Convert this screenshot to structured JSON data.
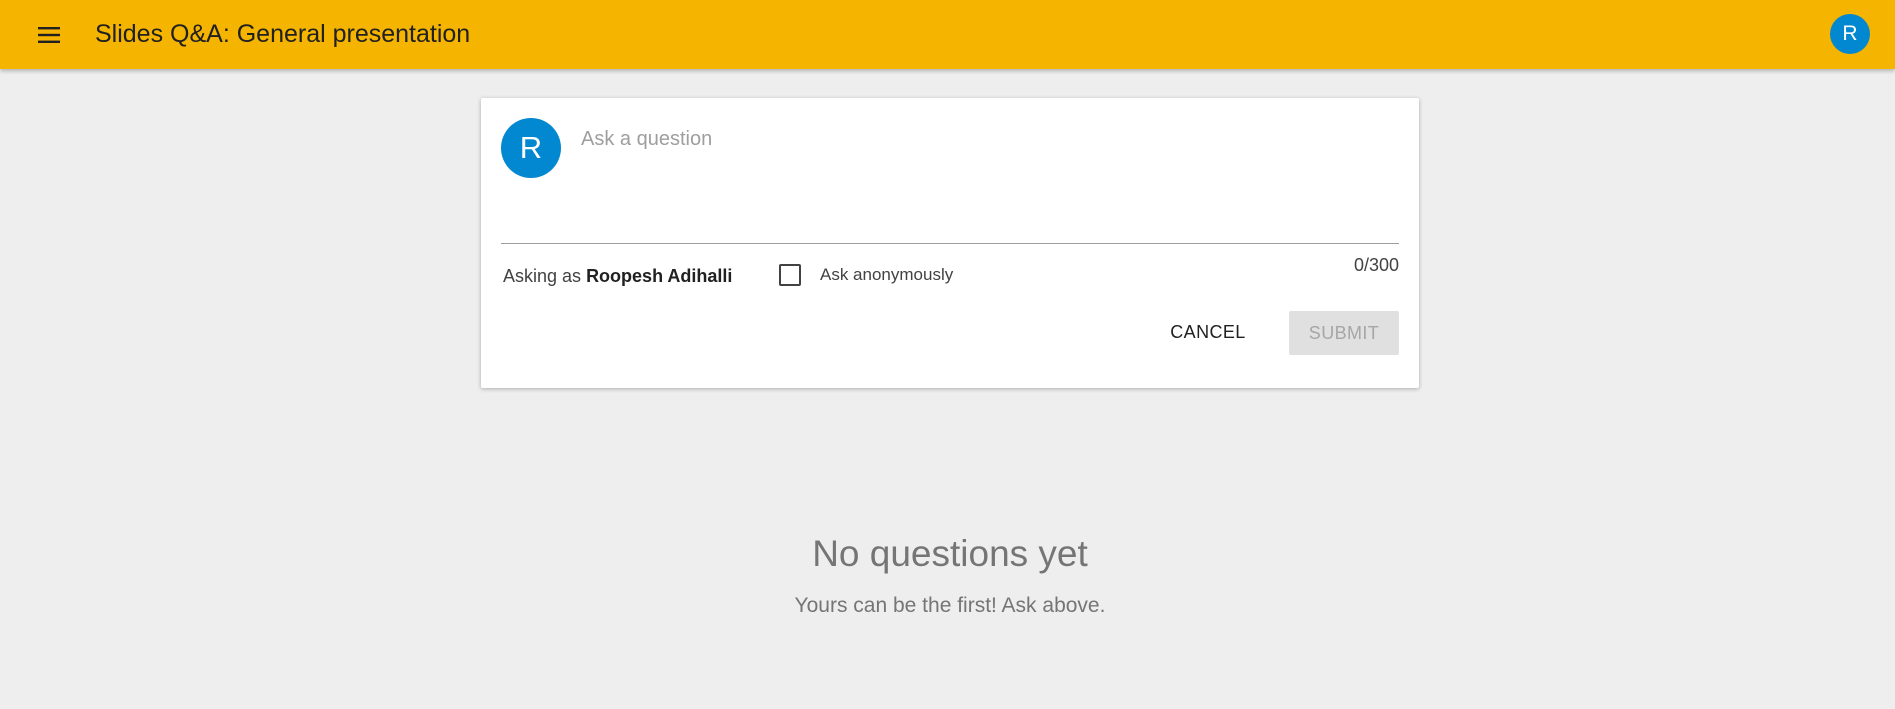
{
  "header": {
    "title": "Slides Q&A: General presentation",
    "menu_icon": "hamburger-menu-icon",
    "avatar_initial": "R",
    "background_color": "#f4b400"
  },
  "composer": {
    "avatar_initial": "R",
    "avatar_color": "#0288d1",
    "input_placeholder": "Ask a question",
    "input_value": "",
    "char_count": "0/300",
    "asking_as_prefix": "Asking as",
    "asking_as_name": "Roopesh Adihalli",
    "anonymous_label": "Ask anonymously",
    "anonymous_checked": false,
    "cancel_label": "CANCEL",
    "submit_label": "SUBMIT"
  },
  "empty_state": {
    "title": "No questions yet",
    "subtitle": "Yours can be the first! Ask above."
  }
}
